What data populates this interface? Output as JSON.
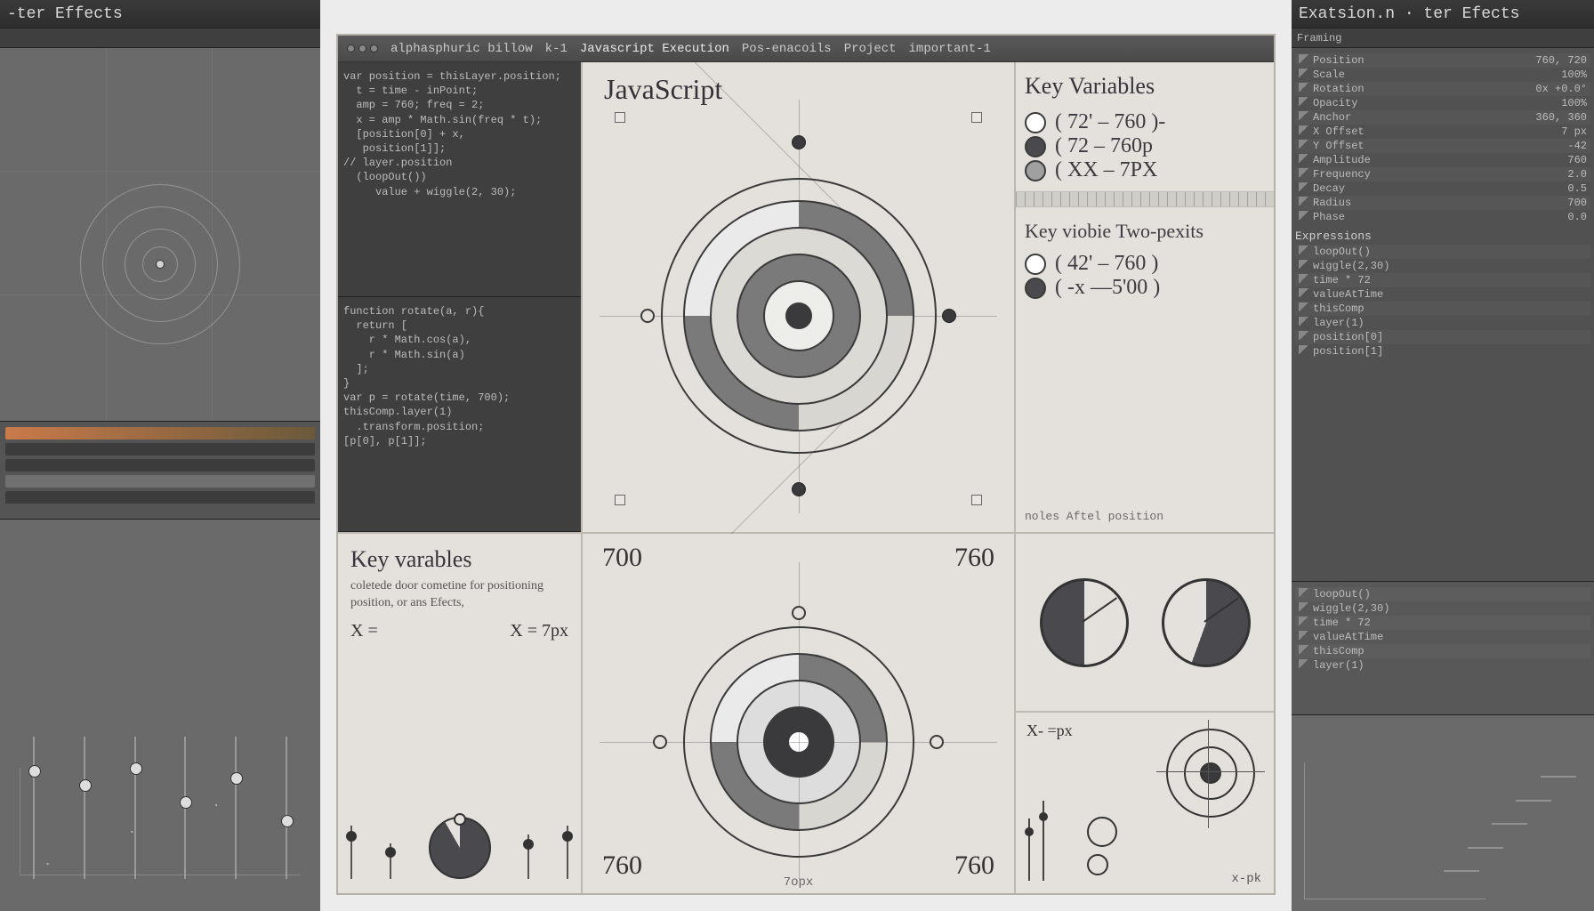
{
  "leftPanel": {
    "title": "-ter Effects",
    "sliders": [
      20,
      30,
      18,
      42,
      25,
      55
    ]
  },
  "center": {
    "titlebar": {
      "segments": [
        "alphasphuric billow",
        "k-1",
        "Javascript Execution",
        "Pos-enacoils",
        "Project",
        "important-1"
      ]
    },
    "code1": "var position = thisLayer.position;\n  t = time - inPoint;\n  amp = 760; freq = 2;\n  x = amp * Math.sin(freq * t);\n  [position[0] + x,\n   position[1]];\n// layer.position\n  (loopOut())\n     value + wiggle(2, 30);",
    "code2": "function rotate(a, r){\n  return [\n    r * Math.cos(a),\n    r * Math.sin(a)\n  ];\n}\nvar p = rotate(time, 700);\nthisComp.layer(1)\n  .transform.position;\n[p[0], p[1]];",
    "row1": {
      "targetHeading": "JavaScript",
      "varsHeading": "Key Variables",
      "vars1": [
        {
          "dot": "white",
          "expr": "( 72' – 760 )-"
        },
        {
          "dot": "dark",
          "expr": "( 72 – 760p"
        },
        {
          "dot": "grey",
          "expr": "( XX – 7PX"
        }
      ],
      "subHeading": "Key viobie Two-pexits",
      "vars2": [
        {
          "dot": "white",
          "expr": "( 42' – 760 )"
        },
        {
          "dot": "dark",
          "expr": "( -x —5'00 )"
        }
      ],
      "footnote": "noles   Aftel  position"
    },
    "row2": {
      "kv": {
        "heading": "Key varables",
        "sub": "coletede door cometine for positioning position, or ans Efects,",
        "exprLeft": "X =",
        "exprRight": "X = 7px"
      },
      "target2": {
        "tl": "700",
        "tr": "760",
        "bl": "760",
        "br": "760",
        "caption": "7opx"
      },
      "dials": {
        "label": "X- =px",
        "foot": "x-pk"
      }
    }
  },
  "rightPanel": {
    "title": "Exatsion.n · ter Efects",
    "tabs": [
      "Framing"
    ],
    "section1": [
      {
        "k": "Position",
        "v": "760, 720"
      },
      {
        "k": "Scale",
        "v": "100%"
      },
      {
        "k": "Rotation",
        "v": "0x +0.0°"
      },
      {
        "k": "Opacity",
        "v": "100%"
      },
      {
        "k": "Anchor",
        "v": "360, 360"
      },
      {
        "k": "X Offset",
        "v": "7 px"
      },
      {
        "k": "Y Offset",
        "v": "-42"
      },
      {
        "k": "Amplitude",
        "v": "760"
      },
      {
        "k": "Frequency",
        "v": "2.0"
      },
      {
        "k": "Decay",
        "v": "0.5"
      },
      {
        "k": "Radius",
        "v": "700"
      },
      {
        "k": "Phase",
        "v": "0.0"
      }
    ],
    "sectionHeading2": "Expressions",
    "section2": [
      {
        "k": "loopOut()",
        "v": ""
      },
      {
        "k": "wiggle(2,30)",
        "v": ""
      },
      {
        "k": "time * 72",
        "v": ""
      },
      {
        "k": "valueAtTime",
        "v": ""
      },
      {
        "k": "thisComp",
        "v": ""
      },
      {
        "k": "layer(1)",
        "v": ""
      },
      {
        "k": "position[0]",
        "v": ""
      },
      {
        "k": "position[1]",
        "v": ""
      }
    ]
  }
}
